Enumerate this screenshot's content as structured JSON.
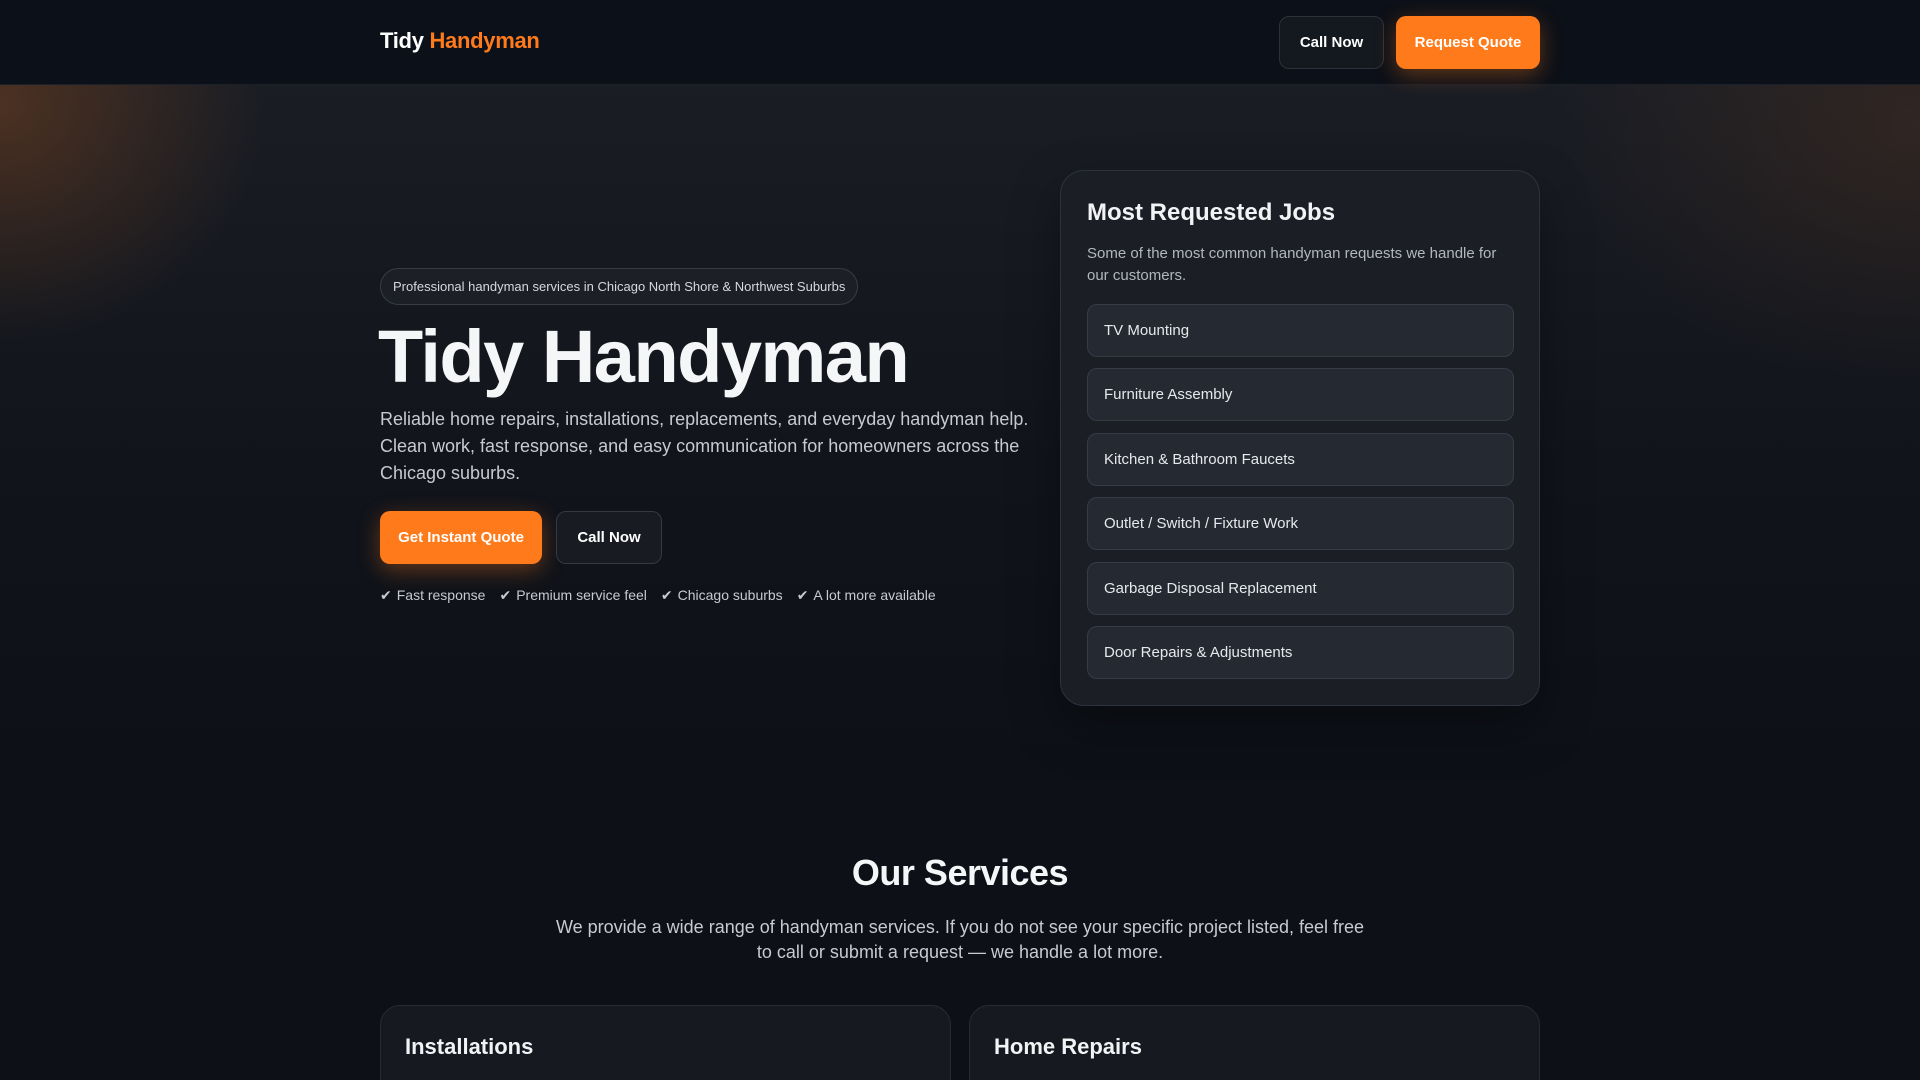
{
  "nav": {
    "brand_first": "Tidy",
    "brand_accent": "Handyman",
    "call_label": "Call Now",
    "quote_label": "Request Quote"
  },
  "hero": {
    "pill": "Professional handyman services in Chicago North Shore & Northwest Suburbs",
    "title": "Tidy Handyman",
    "description": "Reliable home repairs, installations, replacements, and everyday handyman help. Clean work, fast response, and easy communication for homeowners across the Chicago suburbs.",
    "primary_button": "Get Instant Quote",
    "secondary_button": "Call Now",
    "checks": [
      "Fast response",
      "Premium service feel",
      "Chicago suburbs",
      "A lot more available"
    ],
    "check_mark": "✔"
  },
  "jobs": {
    "title": "Most Requested Jobs",
    "description": "Some of the most common handyman requests we handle for our customers.",
    "items": [
      "TV Mounting",
      "Furniture Assembly",
      "Kitchen & Bathroom Faucets",
      "Outlet / Switch / Fixture Work",
      "Garbage Disposal Replacement",
      "Door Repairs & Adjustments"
    ]
  },
  "services": {
    "title": "Our Services",
    "description": "We provide a wide range of handyman services. If you do not see your specific project listed, feel free to call or submit a request — we handle a lot more.",
    "cards": [
      "Installations",
      "Home Repairs"
    ]
  },
  "colors": {
    "accent": "#ff7a1a",
    "background": "#0d1017",
    "card": "#1b1e25"
  }
}
